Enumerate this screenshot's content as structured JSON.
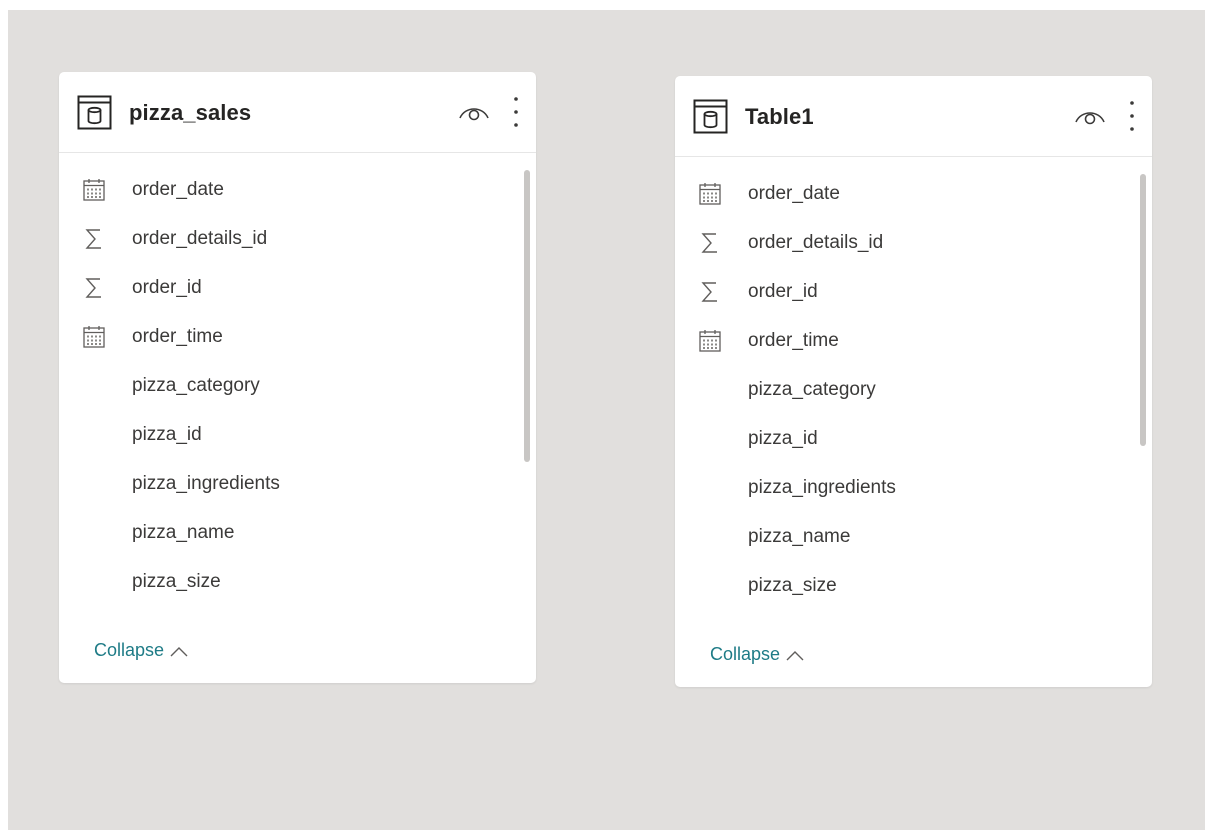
{
  "tables": [
    {
      "title": "pizza_sales",
      "fields": [
        {
          "label": "order_date",
          "icon": "calendar-icon"
        },
        {
          "label": "order_details_id",
          "icon": "sigma-icon"
        },
        {
          "label": "order_id",
          "icon": "sigma-icon"
        },
        {
          "label": "order_time",
          "icon": "calendar-icon"
        },
        {
          "label": "pizza_category",
          "icon": ""
        },
        {
          "label": "pizza_id",
          "icon": ""
        },
        {
          "label": "pizza_ingredients",
          "icon": ""
        },
        {
          "label": "pizza_name",
          "icon": ""
        },
        {
          "label": "pizza_size",
          "icon": ""
        }
      ],
      "collapse_label": "Collapse"
    },
    {
      "title": "Table1",
      "fields": [
        {
          "label": "order_date",
          "icon": "calendar-icon"
        },
        {
          "label": "order_details_id",
          "icon": "sigma-icon"
        },
        {
          "label": "order_id",
          "icon": "sigma-icon"
        },
        {
          "label": "order_time",
          "icon": "calendar-icon"
        },
        {
          "label": "pizza_category",
          "icon": ""
        },
        {
          "label": "pizza_id",
          "icon": ""
        },
        {
          "label": "pizza_ingredients",
          "icon": ""
        },
        {
          "label": "pizza_name",
          "icon": ""
        },
        {
          "label": "pizza_size",
          "icon": ""
        }
      ],
      "collapse_label": "Collapse"
    }
  ],
  "colors": {
    "canvas": "#e1dfdd",
    "card": "#ffffff",
    "text": "#3b3a39",
    "title": "#252423",
    "link": "#1e7b86",
    "scrollbar": "#c8c6c4"
  }
}
